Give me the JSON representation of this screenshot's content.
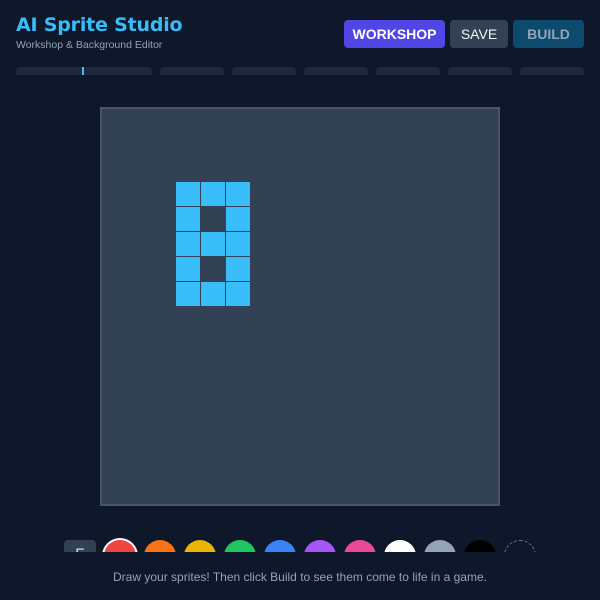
{
  "header": {
    "title": "AI Sprite Studio",
    "subtitle": "Workshop & Background Editor"
  },
  "toolbar": {
    "workshop_label": "WORKSHOP",
    "save_label": "SAVE",
    "build_label": "BUILD"
  },
  "frames": {
    "count": 8,
    "active_index": 0
  },
  "canvas": {
    "background": "#334155",
    "pixel_color": "#38bdf8",
    "rows": [
      [
        1,
        1,
        1
      ],
      [
        1,
        0,
        1
      ],
      [
        1,
        1,
        1
      ],
      [
        1,
        0,
        1
      ],
      [
        1,
        1,
        1
      ]
    ]
  },
  "palette": {
    "tool_label": "E",
    "selected_index": 0,
    "colors": [
      "#ef4444",
      "#f97316",
      "#eab308",
      "#22c55e",
      "#3b82f6",
      "#a855f7",
      "#ec4899",
      "#ffffff",
      "#94a3b8",
      "#000000"
    ],
    "add_label": "+"
  },
  "footer": {
    "hint": "Draw your sprites! Then click Build to see them come to life in a game."
  }
}
